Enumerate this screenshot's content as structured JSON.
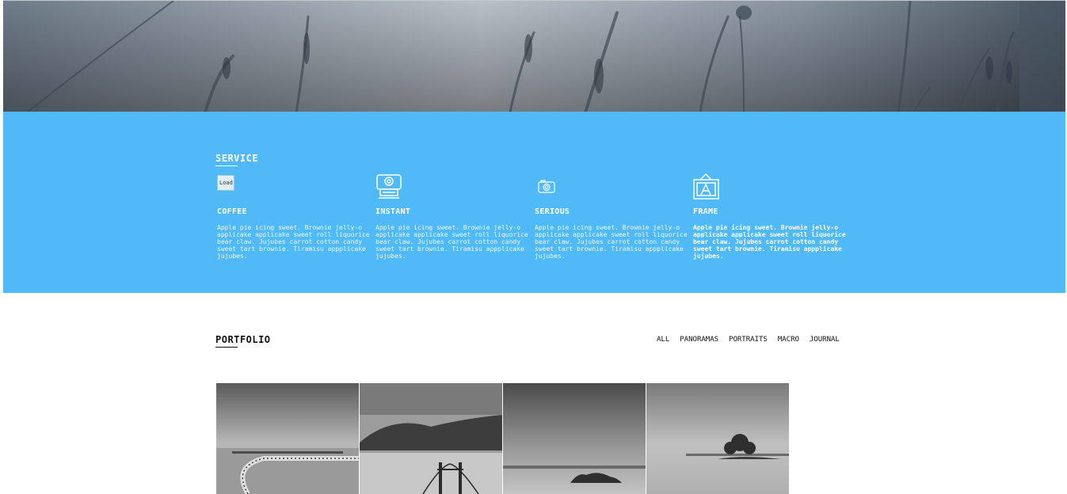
{
  "services": {
    "title": "SERVICE",
    "items": [
      {
        "icon": "broken-image-icon",
        "broken_alt": "Load",
        "name": "COFFEE",
        "text": "Apple pie icing sweet. Brownie jelly-o applicake applicake sweet roll liquorice bear claw. Jujubes carrot cotton candy sweet tart brownie. Tiramisu appplicake jujubes."
      },
      {
        "icon": "polaroid-camera-icon",
        "name": "INSTANT",
        "text": "Apple pie icing sweet. Brownie jelly-o applicake applicake sweet roll liquorice bear claw. Jujubes carrot cotton candy sweet tart brownie. Tiramisu appplicake jujubes."
      },
      {
        "icon": "camera-icon",
        "name": "SERIOUS",
        "text": "Apple pie icing sweet. Brownie jelly-o applicake applicake sweet roll liquorice bear claw. Jujubes carrot cotton candy sweet tart brownie. Tiramisu appplicake jujubes."
      },
      {
        "icon": "framed-picture-icon",
        "name": "FRAME",
        "text": "Apple pie icing sweet. Brownie jelly-o applicake applicake sweet roll liquorice bear claw. Jujubes carrot cotton candy sweet tart brownie. Tiramisu appplicake jujubes."
      }
    ]
  },
  "portfolio": {
    "title": "PORTFOLIO",
    "filters": [
      "ALL",
      "PANORAMAS",
      "PORTRAITS",
      "MACRO",
      "JOURNAL"
    ],
    "tiles": [
      {
        "name": "pier-photo"
      },
      {
        "name": "bridge-photo"
      },
      {
        "name": "seascape-rocks-photo"
      },
      {
        "name": "island-tree-photo"
      }
    ]
  },
  "colors": {
    "service_background": "#50baf9",
    "text_dark": "#111111",
    "text_light": "#ffffff"
  }
}
